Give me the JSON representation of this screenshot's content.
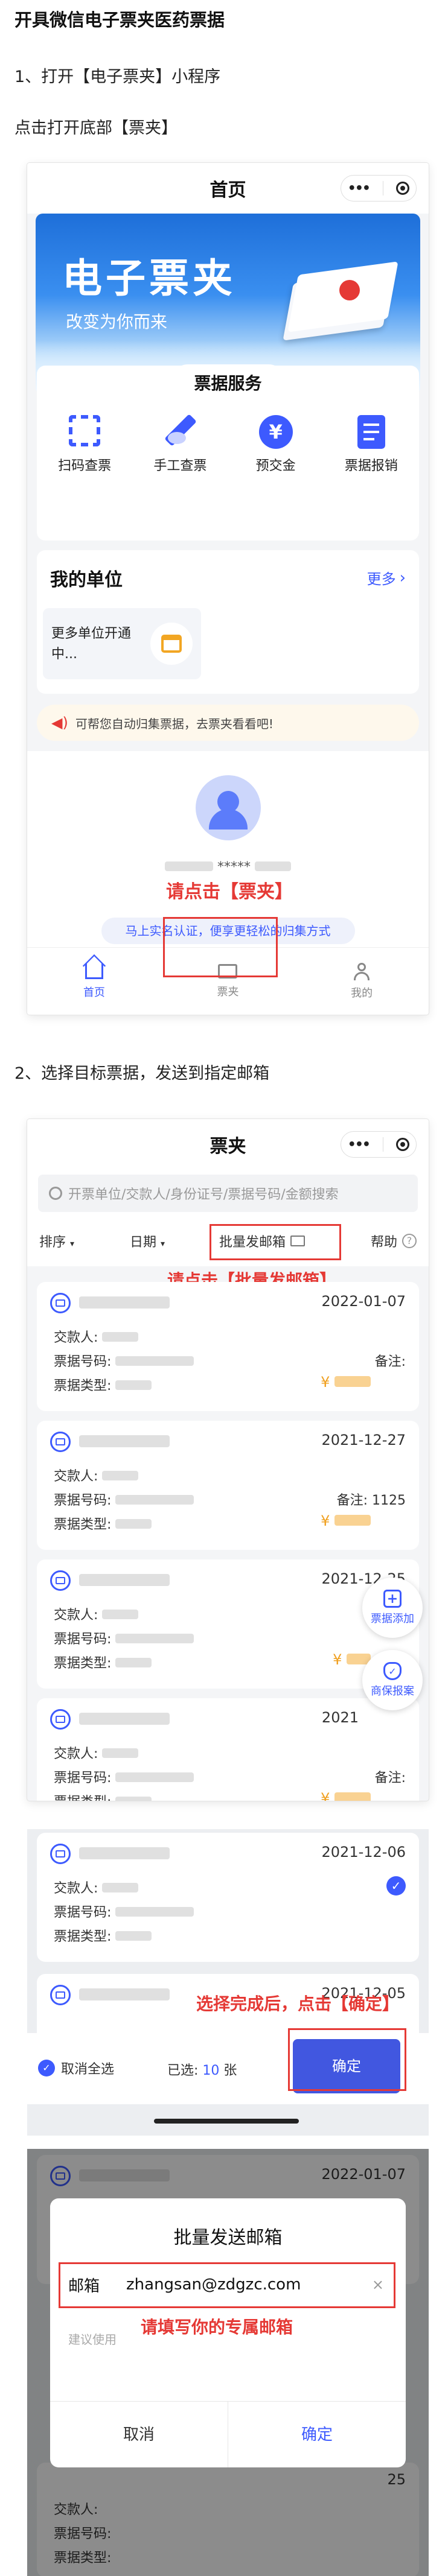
{
  "doc_title": "开具微信电子票夹医药票据",
  "step1": {
    "title": "1、打开【电子票夹】小程序",
    "instruction": "点击打开底部【票夹】",
    "nav_title": "首页",
    "banner_title": "电子票夹",
    "banner_subtitle": "改变为你而来",
    "services_title": "票据服务",
    "services": [
      {
        "label": "扫码查票",
        "icon": "scan-icon"
      },
      {
        "label": "手工查票",
        "icon": "pen-icon"
      },
      {
        "label": "预交金",
        "icon": "yen-icon"
      },
      {
        "label": "票据报销",
        "icon": "receipt-icon"
      }
    ],
    "my_unit_title": "我的单位",
    "more_label": "更多",
    "more_units_text": "更多单位开通中...",
    "notice_text": "可帮您自动归集票据，去票夹看看吧!",
    "masked_name": "*****",
    "link_text": "马上实名认证，便享更轻松的归集方式",
    "tabs": [
      {
        "label": "首页"
      },
      {
        "label": "票夹"
      },
      {
        "label": "我的"
      }
    ],
    "hint": "请点击【票夹】"
  },
  "step2": {
    "title": "2、选择目标票据，发送到指定邮箱",
    "nav_title": "票夹",
    "search_placeholder": "开票单位/交款人/身份证号/票据号码/金额搜索",
    "filter_sort": "排序",
    "filter_date": "日期",
    "batch_email": "批量发邮箱",
    "help": "帮助",
    "hint": "请点击【批量发邮箱】",
    "labels": {
      "payer": "交款人:",
      "ticket_no": "票据号码:",
      "ticket_type": "票据类型:",
      "remark": "备注:",
      "yen": "¥"
    },
    "tickets": [
      {
        "date": "2022-01-07",
        "remark": ""
      },
      {
        "date": "2021-12-27",
        "remark": "1125"
      },
      {
        "date": "2021-12-25",
        "remark": ""
      },
      {
        "date": "2021",
        "remark": ""
      }
    ],
    "fab_add": "票据添加",
    "fab_report": "商保报案"
  },
  "step3": {
    "tickets": [
      {
        "date": "2021-12-06"
      },
      {
        "date": "2021-12-05"
      }
    ],
    "labels": {
      "payer": "交款人:",
      "ticket_no": "票据号码:",
      "ticket_type": "票据类型:",
      "remark": "备注:"
    },
    "cancel_all": "取消全选",
    "selected_label": "已选:",
    "selected_count": "10",
    "selected_unit": "张",
    "confirm": "确定",
    "hint": "选择完成后，点击【确定】"
  },
  "step4": {
    "ticket_date": "2022-01-07",
    "labels": {
      "payer": "交款人:",
      "ticket_no": "票据号码:",
      "ticket_type": "票据类型:"
    },
    "dialog_title": "批量发送邮箱",
    "email_label": "邮箱",
    "email_value": "zhangsan@zdgzc.com",
    "tip_text": "建议使用",
    "hint": "请填写你的专属邮箱",
    "cancel": "取消",
    "confirm": "确定",
    "side_number": "25"
  }
}
